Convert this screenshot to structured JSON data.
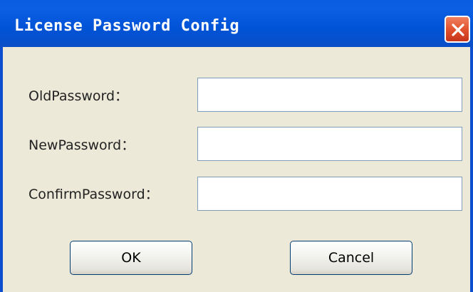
{
  "window": {
    "title": "License Password Config"
  },
  "form": {
    "old_password_label": "OldPassword：",
    "old_password_value": "",
    "new_password_label": "NewPassword：",
    "new_password_value": "",
    "confirm_password_label": "ConfirmPassword：",
    "confirm_password_value": ""
  },
  "buttons": {
    "ok_label": "OK",
    "cancel_label": "Cancel"
  },
  "icons": {
    "close": "close-icon"
  },
  "colors": {
    "titlebar": "#0153d6",
    "close_button": "#e2532f",
    "window_background": "#ece9d8",
    "field_border": "#7f9db9",
    "button_border": "#003c74"
  }
}
